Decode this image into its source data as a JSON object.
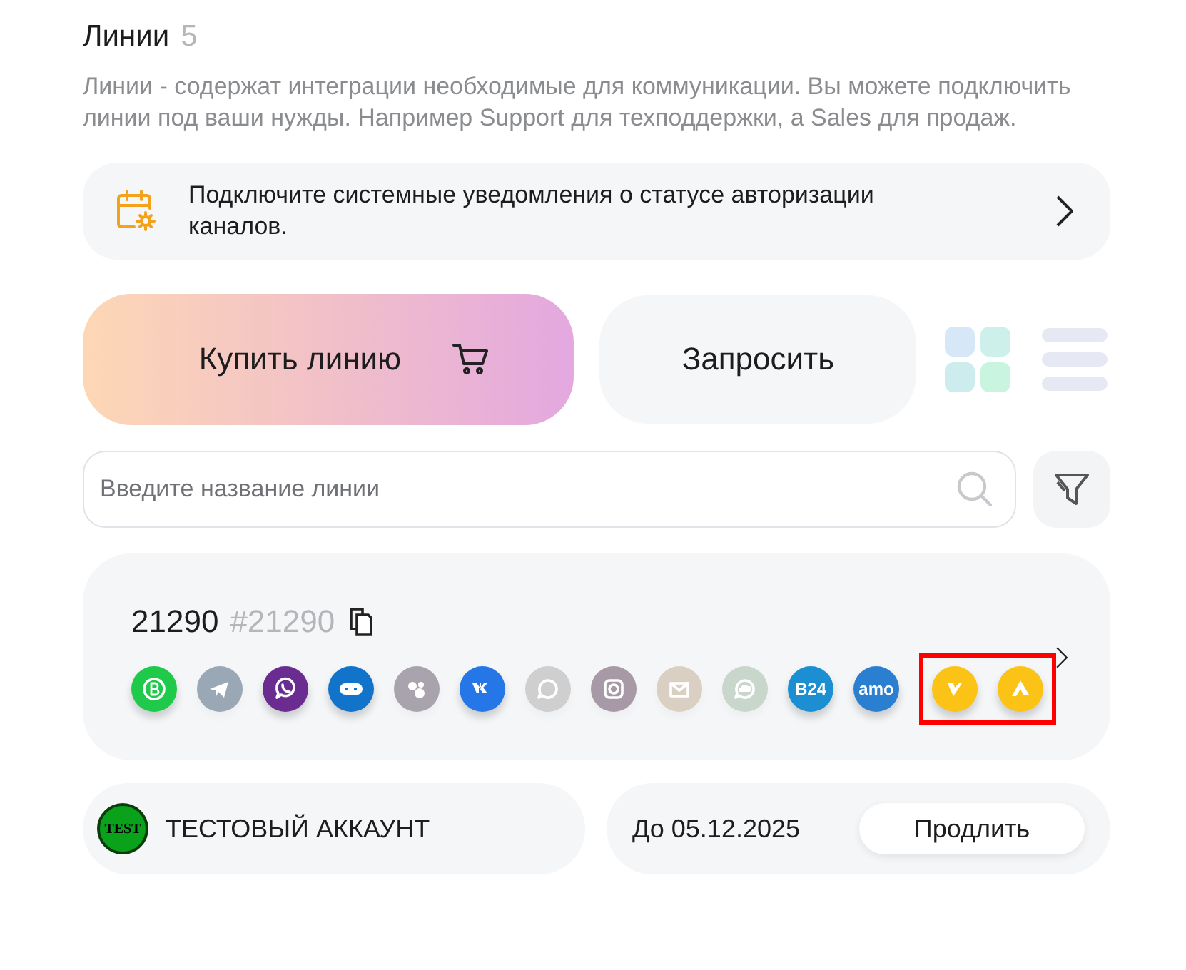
{
  "header": {
    "title": "Линии",
    "count": "5",
    "description": "Линии - содержат интеграции необходимые для коммуникации. Вы можете подключить линии под ваши нужды. Например Support для техподдержки, а Sales для продаж."
  },
  "notice": {
    "text": "Подключите системные уведомления о статусе авторизации каналов."
  },
  "actions": {
    "buy": "Купить линию",
    "request": "Запросить"
  },
  "view_modes": [
    {
      "kind": "grid",
      "selected": true
    },
    {
      "kind": "list",
      "selected": false
    }
  ],
  "search": {
    "placeholder": "Введите название линии"
  },
  "line": {
    "name": "21290",
    "id": "#21290",
    "channels": [
      {
        "kind": "whatsapp-business",
        "color": "#1fc94a",
        "active": true
      },
      {
        "kind": "telegram",
        "color": "#9aa7b4",
        "active": false
      },
      {
        "kind": "viber",
        "color": "#6a2c91",
        "active": true
      },
      {
        "kind": "bot",
        "color": "#1173c9",
        "active": true
      },
      {
        "kind": "dots",
        "color": "#a9a3ad",
        "active": false
      },
      {
        "kind": "vk",
        "color": "#2577e8",
        "active": true
      },
      {
        "kind": "chat",
        "color": "#cfcfcf",
        "active": false
      },
      {
        "kind": "camera",
        "color": "#a79aa6",
        "active": false
      },
      {
        "kind": "mail",
        "color": "#d9cfc2",
        "active": false
      },
      {
        "kind": "cloud-chat",
        "color": "#c9d6cc",
        "active": false
      },
      {
        "kind": "label",
        "label": "B24",
        "color": "#1b8fd1",
        "active": true
      },
      {
        "kind": "label",
        "label": "amo",
        "color": "#2a7fd0",
        "active": true
      }
    ],
    "highlighted_channels": [
      {
        "kind": "check",
        "color": "#fbc316",
        "active": true
      },
      {
        "kind": "triangle",
        "color": "#fbc316",
        "active": true
      }
    ]
  },
  "account": {
    "badge": "TEST",
    "name": "ТЕСТОВЫЙ АККАУНТ",
    "expiry": "До 05.12.2025",
    "renew": "Продлить"
  }
}
